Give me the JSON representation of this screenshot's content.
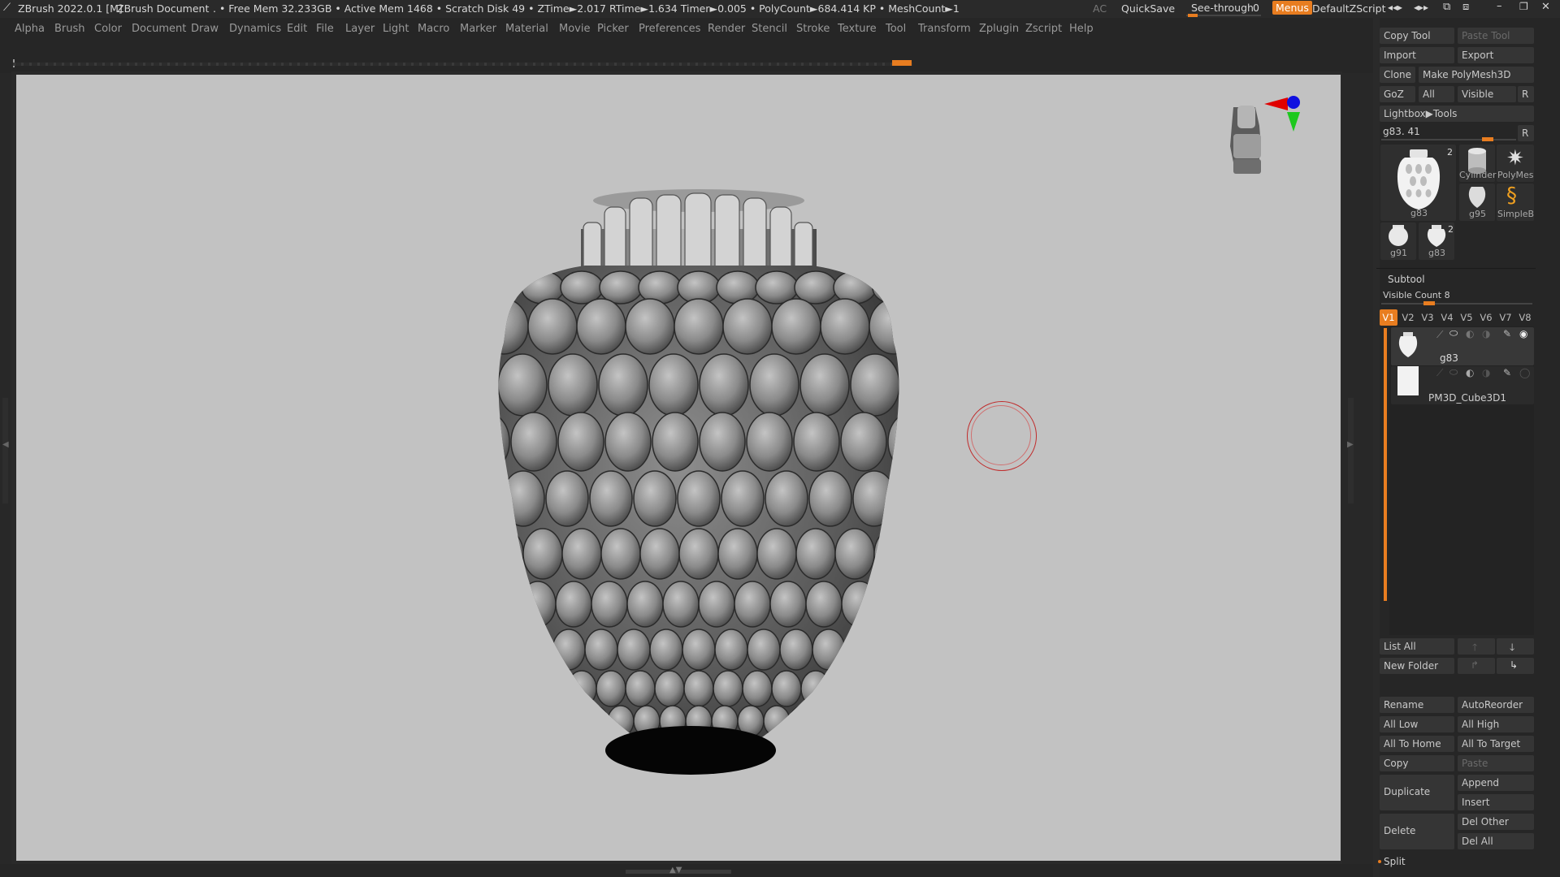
{
  "titlebar": {
    "logo_icon": "zbrush-logo-icon",
    "app_title": "ZBrush 2022.0.1 [M]",
    "document": "ZBrush Document",
    "stats": ". • Free Mem 32.233GB • Active Mem 1468 • Scratch Disk 49 •  ZTime►2.017 RTime►1.634 Timer►0.005 • PolyCount►684.414 KP  • MeshCount►1",
    "ac": "AC",
    "quicksave": "QuickSave",
    "see_through_label": "See-through",
    "see_through_value": "0",
    "menus": "Menus",
    "script": "DefaultZScript"
  },
  "menubar": [
    "Alpha",
    "Brush",
    "Color",
    "Document",
    "Draw",
    "Dynamics",
    "Edit",
    "File",
    "Layer",
    "Light",
    "Macro",
    "Marker",
    "Material",
    "Movie",
    "Picker",
    "Preferences",
    "Render",
    "Stencil",
    "Stroke",
    "Texture",
    "Tool",
    "Transform",
    "Zplugin",
    "Zscript",
    "Help"
  ],
  "tool_panel": {
    "copy_tool": "Copy Tool",
    "paste_tool": "Paste Tool",
    "import": "Import",
    "export": "Export",
    "clone": "Clone",
    "make_polymesh": "Make PolyMesh3D",
    "goz": "GoZ",
    "all": "All",
    "visible": "Visible",
    "r": "R",
    "lightbox_tools": "Lightbox▶Tools",
    "current_tool": "g83. 41",
    "r2": "R",
    "thumbs": [
      {
        "name": "g83",
        "count": "2"
      },
      {
        "name": "Cylinder"
      },
      {
        "name": "PolyMes"
      },
      {
        "name": "g95"
      },
      {
        "name": "SimpleB"
      },
      {
        "name": "g91"
      },
      {
        "name": "g83",
        "count": "2"
      }
    ]
  },
  "subtool": {
    "header": "Subtool",
    "visible_count": "Visible Count 8",
    "tabs": [
      "V1",
      "V2",
      "V3",
      "V4",
      "V5",
      "V6",
      "V7",
      "V8"
    ],
    "active_tab": "V1",
    "items": [
      {
        "name": "g83"
      },
      {
        "name": "PM3D_Cube3D1"
      }
    ],
    "list_all": "List All",
    "new_folder": "New Folder",
    "rename": "Rename",
    "autoreorder": "AutoReorder",
    "all_low": "All Low",
    "all_high": "All High",
    "all_to_home": "All To Home",
    "all_to_target": "All To Target",
    "copy": "Copy",
    "paste": "Paste",
    "duplicate": "Duplicate",
    "append": "Append",
    "insert": "Insert",
    "delete": "Delete",
    "del_other": "Del Other",
    "del_all": "Del All",
    "split": "Split"
  },
  "colors": {
    "accent": "#e87d20",
    "canvas_bg": "#c2c2c2",
    "panel_bg": "#262626"
  }
}
